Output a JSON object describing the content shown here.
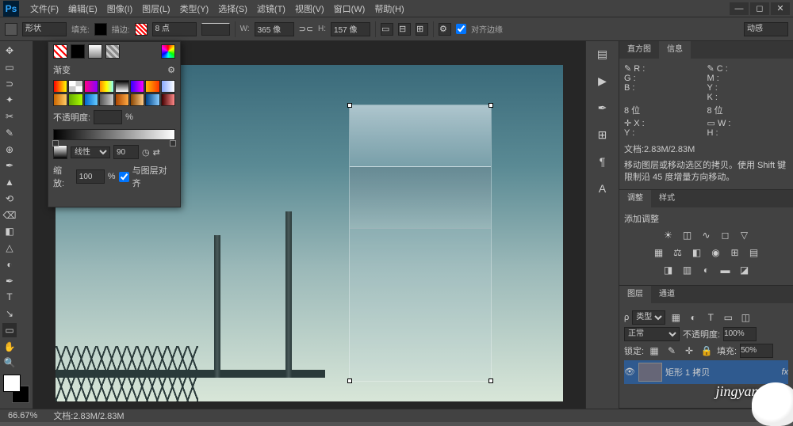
{
  "menu": {
    "items": [
      "文件(F)",
      "编辑(E)",
      "图像(I)",
      "图层(L)",
      "类型(Y)",
      "选择(S)",
      "滤镜(T)",
      "视图(V)",
      "窗口(W)",
      "帮助(H)"
    ]
  },
  "optbar": {
    "shape": "形状",
    "fill": "填充:",
    "stroke": "描边:",
    "weight": "8 点",
    "w_lbl": "W:",
    "w_val": "365 像",
    "h_lbl": "H:",
    "h_val": "157 像",
    "align_edge": "对齐边缘",
    "mode": "动感"
  },
  "tools": [
    "▭",
    "⬚",
    "⊕",
    "◫",
    "⟋",
    "✂",
    "✎",
    "✒",
    "⌫",
    "⟲",
    "△",
    "↘",
    "T",
    "◻",
    "✋",
    "🔍"
  ],
  "grad": {
    "title": "渐变",
    "opacity_lbl": "不透明度:",
    "opacity_val": "",
    "pct": "%",
    "type": "线性",
    "angle": "90",
    "scale_lbl": "缩放:",
    "scale_val": "100",
    "align": "与图层对齐"
  },
  "presets": [
    "linear-gradient(to right,#f00,#ff0)",
    "repeating-conic-gradient(#ccc 0 25%,#fff 0 50%)",
    "linear-gradient(to right,#f08,#80f)",
    "linear-gradient(to right,#f80,#ff0,#8ff)",
    "linear-gradient(to bottom,#000,#fff)",
    "linear-gradient(to right,#30f,#f0f)",
    "linear-gradient(to right,#fb0,#f30)",
    "linear-gradient(to right,#8af,#fff)",
    "linear-gradient(to right,#c60,#fc6)",
    "linear-gradient(to right,#6a0,#af0)",
    "linear-gradient(to right,#06c,#6cf)",
    "linear-gradient(to right,#555,#ccc)",
    "linear-gradient(to right,#a40,#fa4)",
    "linear-gradient(to right,#840,#fc8)",
    "linear-gradient(to right,#048,#8cf)",
    "linear-gradient(to right,#400,#f88)"
  ],
  "info": {
    "tab1": "直方图",
    "tab2": "信息",
    "r": "R :",
    "g": "G :",
    "b": "B :",
    "c": "C :",
    "m": "M :",
    "y": "Y :",
    "k": "K :",
    "bit": "8 位",
    "x": "X :",
    "y2": "Y :",
    "w": "W :",
    "h": "H :",
    "doc": "文档:2.83M/2.83M",
    "hint": "移动图层或移动选区的拷贝。使用 Shift 键限制沿 45 度增量方向移动。"
  },
  "adjust": {
    "tab1": "调整",
    "tab2": "样式",
    "title": "添加调整"
  },
  "layers": {
    "tab1": "图层",
    "tab2": "通道",
    "kind": "类型",
    "blend": "正常",
    "opac_lbl": "不透明度:",
    "opac": "100%",
    "lock": "锁定:",
    "fill_lbl": "填充:",
    "fill": "50%",
    "layer1": "矩形 1 拷贝"
  },
  "status": {
    "zoom": "66.67%",
    "doc": "文档:2.83M/2.83M"
  },
  "watermark": "jingyan.b"
}
